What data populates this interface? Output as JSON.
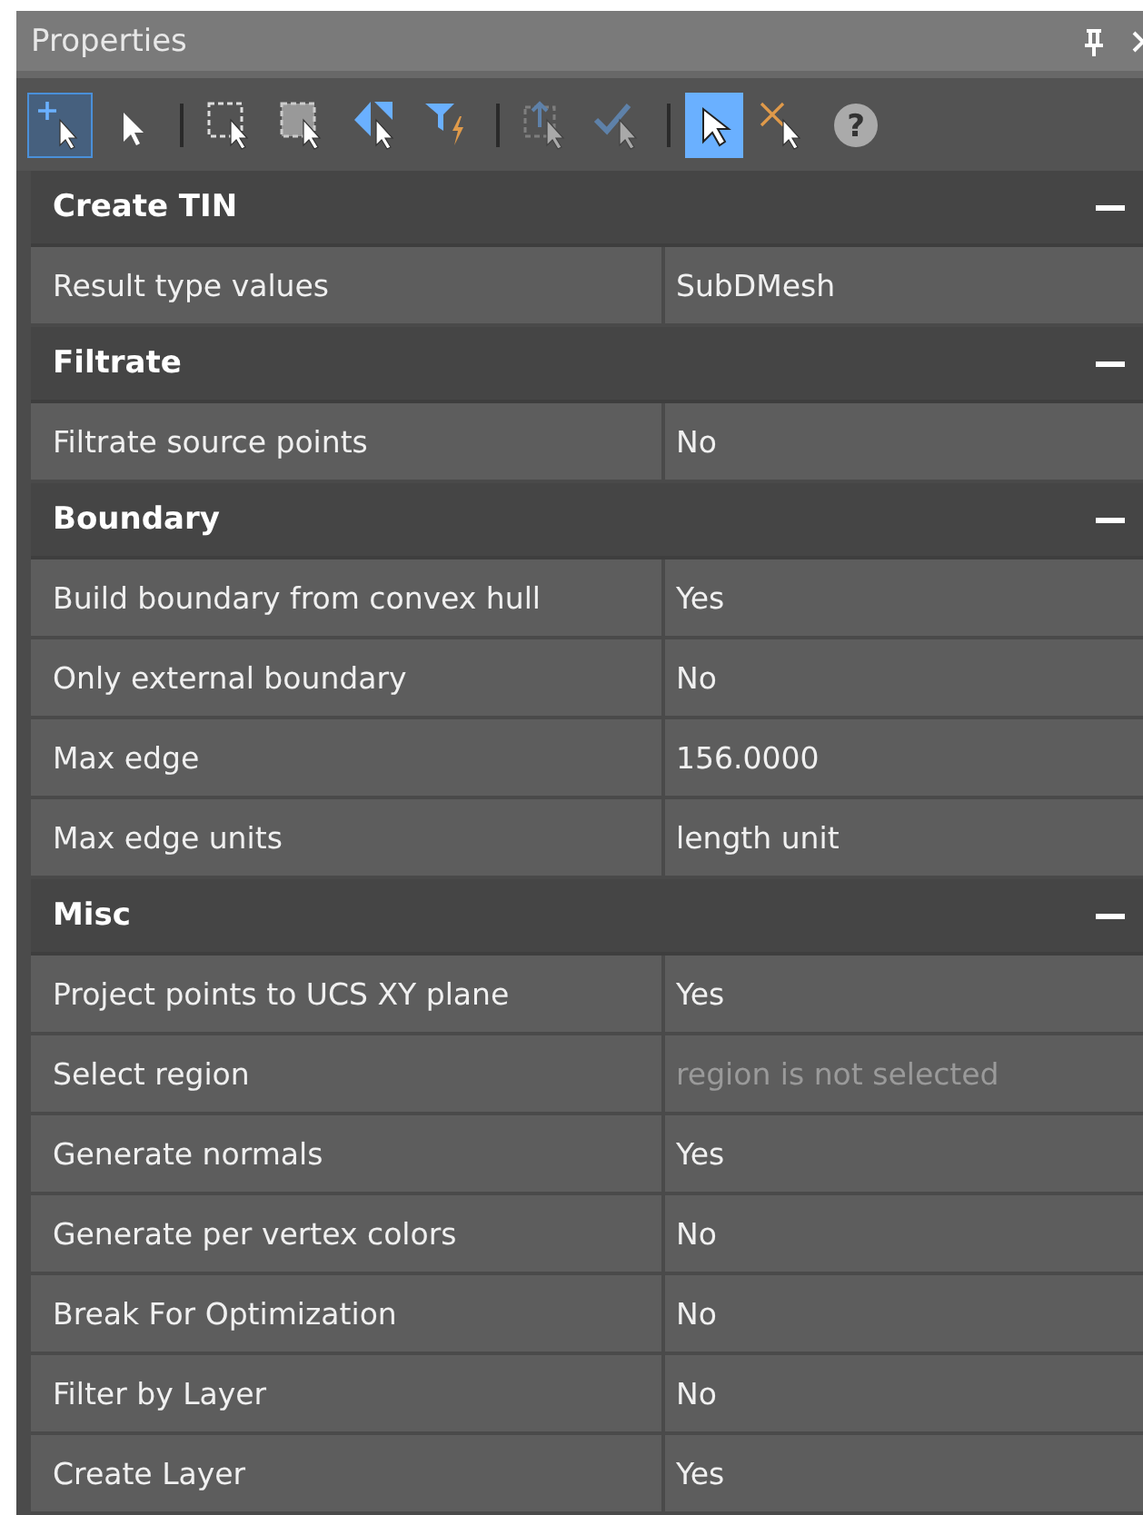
{
  "window": {
    "title": "Properties"
  },
  "toolbar": [
    {
      "kind": "add-select",
      "selected": true,
      "disabled": false
    },
    {
      "kind": "select",
      "selected": false,
      "disabled": false
    },
    {
      "kind": "separator"
    },
    {
      "kind": "window-select",
      "selected": false,
      "disabled": false
    },
    {
      "kind": "crossing-select",
      "selected": false,
      "disabled": false
    },
    {
      "kind": "mirror-select",
      "selected": false,
      "disabled": false
    },
    {
      "kind": "quick-filter",
      "selected": false,
      "disabled": false
    },
    {
      "kind": "separator"
    },
    {
      "kind": "upload-select",
      "selected": false,
      "disabled": true
    },
    {
      "kind": "check-select",
      "selected": false,
      "disabled": true
    },
    {
      "kind": "separator"
    },
    {
      "kind": "pointer",
      "selected": true,
      "disabled": false
    },
    {
      "kind": "cross-select",
      "selected": false,
      "disabled": false
    },
    {
      "kind": "help",
      "label": "?",
      "selected": false,
      "disabled": false
    }
  ],
  "sections": [
    {
      "title": "Create TIN",
      "expanded": true,
      "rows": [
        {
          "label": "Result type values",
          "value": "SubDMesh",
          "disabled": false
        }
      ]
    },
    {
      "title": "Filtrate",
      "expanded": true,
      "rows": [
        {
          "label": "Filtrate source points",
          "value": "No",
          "disabled": false
        }
      ]
    },
    {
      "title": "Boundary",
      "expanded": true,
      "rows": [
        {
          "label": "Build boundary from convex hull",
          "value": "Yes",
          "disabled": false
        },
        {
          "label": "Only external boundary",
          "value": "No",
          "disabled": false
        },
        {
          "label": "Max edge",
          "value": "156.0000",
          "disabled": false
        },
        {
          "label": "Max edge units",
          "value": "length unit",
          "disabled": false
        }
      ]
    },
    {
      "title": "Misc",
      "expanded": true,
      "rows": [
        {
          "label": "Project points to UCS XY plane",
          "value": "Yes",
          "disabled": false
        },
        {
          "label": "Select region",
          "value": "region is not selected",
          "disabled": true
        },
        {
          "label": "Generate normals",
          "value": "Yes",
          "disabled": false
        },
        {
          "label": "Generate per vertex colors",
          "value": "No",
          "disabled": false
        },
        {
          "label": "Break For Optimization",
          "value": "No",
          "disabled": false
        },
        {
          "label": "Filter by Layer",
          "value": "No",
          "disabled": false
        },
        {
          "label": "Create Layer",
          "value": "Yes",
          "disabled": false
        }
      ]
    }
  ]
}
